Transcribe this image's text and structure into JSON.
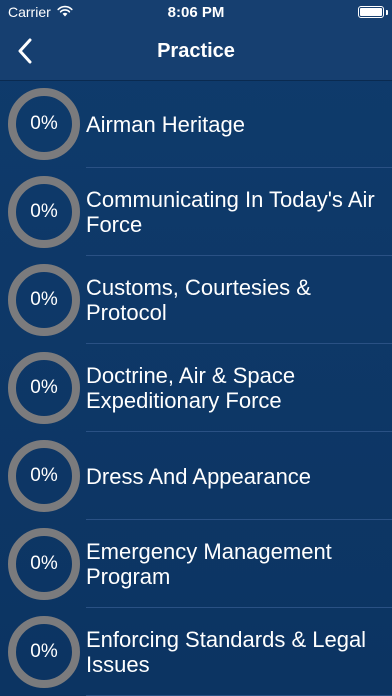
{
  "status_bar": {
    "carrier": "Carrier",
    "time": "8:06 PM",
    "wifi_icon": "wifi-icon",
    "battery_icon": "battery-icon"
  },
  "nav": {
    "title": "Practice",
    "back_icon": "chevron-left-icon"
  },
  "colors": {
    "background": "#0d3766",
    "bar": "#163f70",
    "ring": "#7b7b7d",
    "separator": "#2a5184"
  },
  "items": [
    {
      "label": "Airman Heritage",
      "progress": "0%"
    },
    {
      "label": "Communicating In Today's Air Force",
      "progress": "0%"
    },
    {
      "label": "Customs, Courtesies & Protocol",
      "progress": "0%"
    },
    {
      "label": "Doctrine, Air & Space Expeditionary Force",
      "progress": "0%"
    },
    {
      "label": "Dress And Appearance",
      "progress": "0%"
    },
    {
      "label": "Emergency Management Program",
      "progress": "0%"
    },
    {
      "label": "Enforcing Standards & Legal Issues",
      "progress": "0%"
    }
  ]
}
